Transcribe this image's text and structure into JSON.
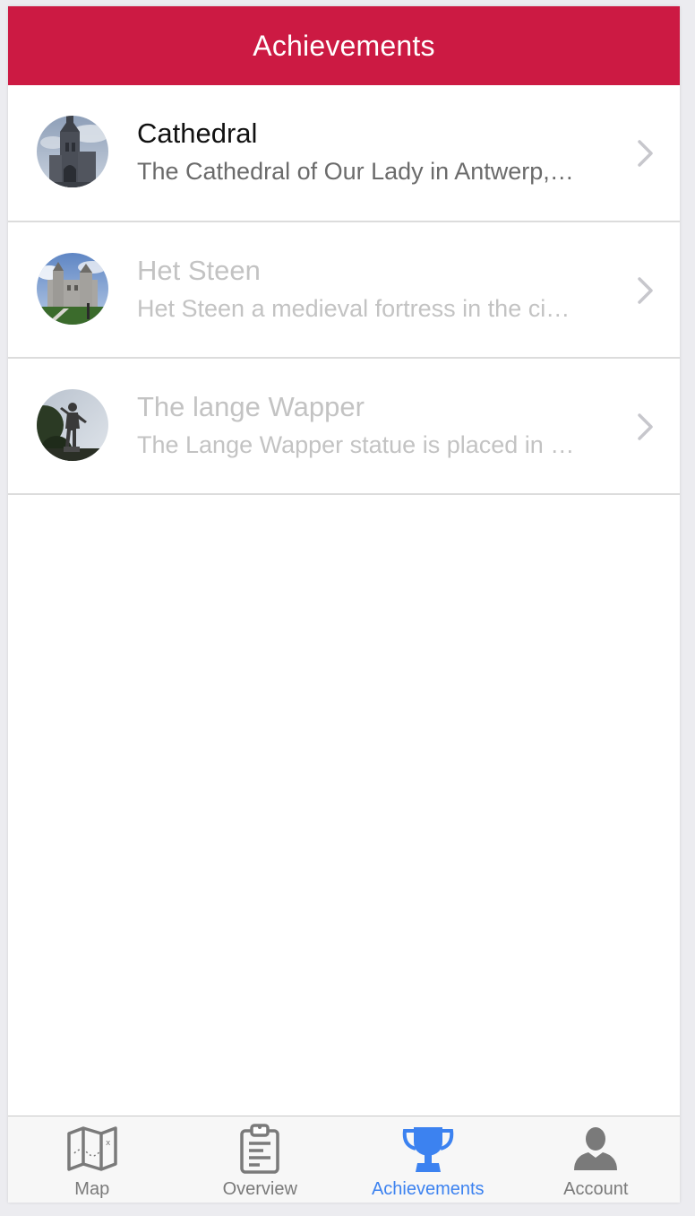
{
  "header": {
    "title": "Achievements"
  },
  "achievements": [
    {
      "title": "Cathedral",
      "subtitle": "The Cathedral of Our Lady in Antwerp, Belgium",
      "state": "unlocked",
      "image_icon": "cathedral-photo"
    },
    {
      "title": "Het Steen",
      "subtitle": "Het Steen a medieval fortress in the city centre",
      "state": "locked",
      "image_icon": "castle-photo"
    },
    {
      "title": "The lange Wapper",
      "subtitle": "The Lange Wapper statue is placed in front of Het Steen",
      "state": "locked",
      "image_icon": "statue-photo"
    }
  ],
  "tabbar": {
    "items": [
      {
        "label": "Map",
        "icon": "map-icon",
        "selected": false
      },
      {
        "label": "Overview",
        "icon": "clipboard-icon",
        "selected": false
      },
      {
        "label": "Achievements",
        "icon": "trophy-icon",
        "selected": true
      },
      {
        "label": "Account",
        "icon": "user-icon",
        "selected": false
      }
    ]
  },
  "colors": {
    "brand": "#cc1a43",
    "tab_selected": "#3c82f0",
    "tab_unselected": "#7a7a7a",
    "text_locked": "#c3c3c3"
  }
}
